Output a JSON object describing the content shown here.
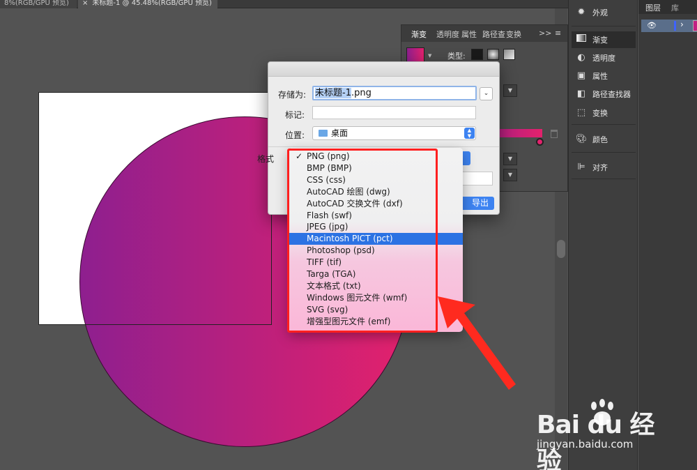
{
  "tabs": {
    "doc1_title": "8%(RGB/GPU 预览)",
    "doc2_close": "×",
    "doc2_title": "未标题-1 @ 45.48%(RGB/GPU 预览)"
  },
  "gradient_panel": {
    "tabs": [
      "渐变",
      "透明度",
      "属性",
      "路径查",
      "变换"
    ],
    "overflow": ">>",
    "menu": "≡",
    "type_label": "类型:",
    "gradient_start": "#8e1f8f",
    "gradient_end": "#e3216c"
  },
  "dock": {
    "items": [
      {
        "label": "外观",
        "icon": "sun-icon"
      },
      {
        "label": "渐变",
        "icon": "gradient-icon",
        "active": true
      },
      {
        "label": "透明度",
        "icon": "transparency-icon"
      },
      {
        "label": "属性",
        "icon": "attributes-icon"
      },
      {
        "label": "路径查找器",
        "icon": "pathfinder-icon"
      },
      {
        "label": "变换",
        "icon": "transform-icon"
      },
      {
        "label": "颜色",
        "icon": "palette-icon"
      },
      {
        "label": "对齐",
        "icon": "align-icon"
      }
    ]
  },
  "layers": {
    "tab_layers": "图层",
    "tab_library": "库"
  },
  "dialog": {
    "save_as_label": "存储为:",
    "filename_selected": "未标题-1",
    "filename_ext": ".png",
    "tags_label": "标记:",
    "where_label": "位置:",
    "where_value": "桌面",
    "format_label": "格式",
    "export_button": "导出"
  },
  "format_menu": {
    "checked_index": 0,
    "selected_index": 7,
    "items": [
      "PNG (png)",
      "BMP (BMP)",
      "CSS (css)",
      "AutoCAD 绘图 (dwg)",
      "AutoCAD 交换文件 (dxf)",
      "Flash (swf)",
      "JPEG (jpg)",
      "Macintosh PICT (pct)",
      "Photoshop (psd)",
      "TIFF (tif)",
      "Targa (TGA)",
      "文本格式 (txt)",
      "Windows 图元文件 (wmf)",
      "SVG (svg)",
      "增强型图元文件 (emf)"
    ]
  },
  "annotation": {
    "color": "#ff1f1f"
  },
  "watermark": {
    "logo": "Bai  du 经验",
    "url": "jingyan.baidu.com"
  }
}
